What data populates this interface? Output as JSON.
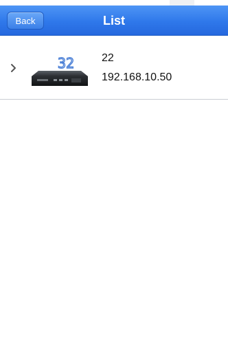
{
  "header": {
    "back_label": "Back",
    "title": "List"
  },
  "devices": [
    {
      "name": "22",
      "ip": "192.168.10.50",
      "icon_number": "32",
      "icon": "network-dvr-icon"
    }
  ],
  "colors": {
    "titlebar": "#2f78ea",
    "icon_number": "#4a7fd6"
  }
}
